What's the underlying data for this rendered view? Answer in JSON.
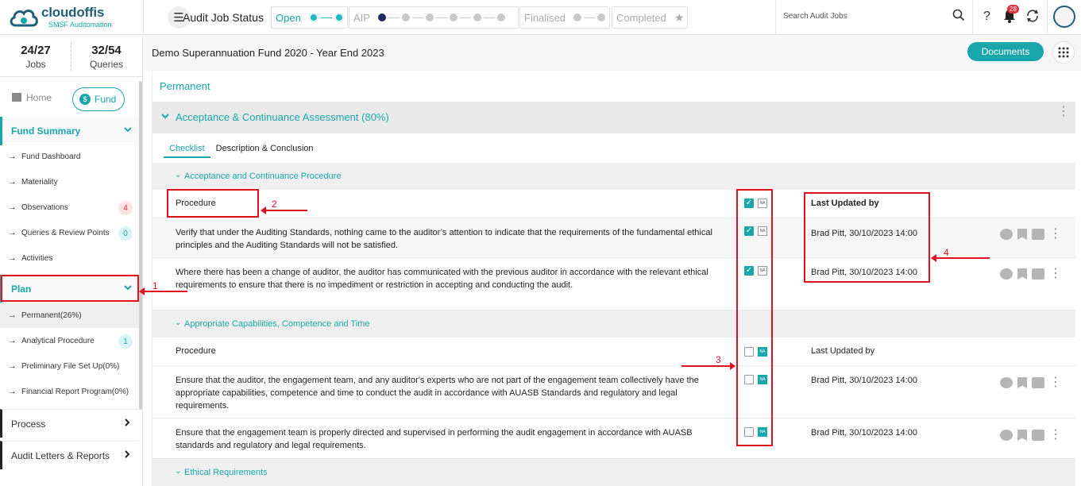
{
  "header": {
    "brand": "cloudoffis",
    "tagline": "SMSF Auditomation",
    "menu_icon": "hamburger-icon",
    "title": "Audit Job Status",
    "statuses": [
      {
        "label": "Open"
      },
      {
        "label": "AIP"
      },
      {
        "label": "Finalised"
      },
      {
        "label": "Completed"
      }
    ],
    "search_placeholder": "Search Audit Jobs",
    "notification_count": "28",
    "colors": {
      "accent": "#18a6ab",
      "brand": "#1f5f79",
      "annotation": "#e0101e"
    }
  },
  "sidebar": {
    "jobs_value": "24/27",
    "jobs_label": "Jobs",
    "queries_value": "32/54",
    "queries_label": "Queries",
    "home_label": "Home",
    "fund_label": "Fund",
    "fund_summary": {
      "title": "Fund Summary",
      "items": [
        {
          "label": "Fund Dashboard",
          "count": ""
        },
        {
          "label": "Materiality",
          "count": ""
        },
        {
          "label": "Observations",
          "count": "4"
        },
        {
          "label": "Queries & Review Points",
          "count": "0"
        },
        {
          "label": "Activities",
          "count": ""
        }
      ]
    },
    "plan": {
      "title": "Plan",
      "items": [
        {
          "label": "Permanent(26%)",
          "count": ""
        },
        {
          "label": "Analytical Procedure",
          "count": "1"
        },
        {
          "label": "Preliminary File Set Up(0%)",
          "count": ""
        },
        {
          "label": "Financial Report Program(0%)",
          "count": ""
        }
      ]
    },
    "process_label": "Process",
    "audit_letters_label": "Audit Letters & Reports"
  },
  "main": {
    "fund_title": "Demo Superannuation Fund 2020 - Year End 2023",
    "documents_label": "Documents",
    "section_label": "Permanent",
    "accordion_title": "Acceptance & Continuance Assessment (80%)",
    "tabs": [
      {
        "label": "Checklist"
      },
      {
        "label": "Description & Conclusion"
      }
    ],
    "groups": [
      {
        "title": "Acceptance and Continuance Procedure",
        "procedure_header": "Procedure",
        "updated_header": "Last Updated by",
        "rows": [
          {
            "text": "Verify that under the Auditing Standards, nothing came to the auditor’s attention to indicate that the requirements of the fundamental ethical principles and the Auditing Standards will not be satisfied.",
            "updated": "Brad Pitt, 30/10/2023 14:00"
          },
          {
            "text": "Where there has been a change of auditor, the auditor has communicated with the previous auditor in accordance with the relevant ethical requirements to ensure that there is no impediment or restriction in accepting and conducting the audit.",
            "updated": "Brad Pitt, 30/10/2023 14:00"
          }
        ]
      },
      {
        "title": "Appropriate Capabilities, Competence and Time",
        "procedure_header": "Procedure",
        "updated_header": "Last Updated by",
        "rows": [
          {
            "text": "Ensure that the auditor, the engagement team, and any auditor's experts who are not part of the engagement team collectively have the appropriate capabilities, competence and time to conduct the audit in accordance with AUASB Standards and regulatory and legal requirements.",
            "updated": "Brad Pitt, 30/10/2023 14:00"
          },
          {
            "text": "Ensure that the engagement team is properly directed and supervised in performing the audit engagement in accordance with AUASB  standards and regulatory and legal requirements.",
            "updated": "Brad Pitt, 30/10/2023 14:00"
          }
        ]
      },
      {
        "title": "Ethical Requirements"
      }
    ],
    "na_label": "NA"
  },
  "annotations": [
    "1",
    "2",
    "3",
    "4"
  ]
}
